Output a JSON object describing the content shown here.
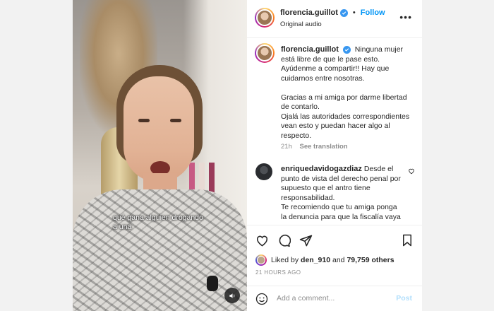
{
  "post": {
    "username": "florencia.guillot",
    "follow_label": "Follow",
    "audio": "Original audio",
    "video_caption": "qué gana alguien drogando a una",
    "caption": {
      "lines": [
        "Ninguna mujer está libre de que le pase esto. Ayúdenme a compartir!! Hay que cuidarnos entre nosotras.",
        "Gracias a mi amiga por darme libertad de contarlo.",
        "Ojalá las autoridades correspondientes vean esto y puedan hacer algo al respecto."
      ],
      "time": "21h",
      "see_translation": "See translation"
    },
    "comment": {
      "username": "enriquedavidogazdiaz",
      "text": "Desde el punto de vista del derecho penal por supuesto que el antro tiene responsabilidad.",
      "text2": "Te recomiendo que tu amiga ponga la denuncia para que la fiscalía vaya"
    },
    "likes": {
      "prefix": "Liked by",
      "user": "den_910",
      "connector": "and",
      "others": "79,759 others"
    },
    "timestamp": "21 HOURS AGO",
    "add_comment_placeholder": "Add a comment...",
    "post_label": "Post"
  },
  "icons": {
    "verified": "verified-badge-icon",
    "more": "more-options-icon",
    "like": "heart-icon",
    "comment": "comment-icon",
    "share": "share-icon",
    "save": "bookmark-icon",
    "emoji": "emoji-icon",
    "mute": "speaker-icon"
  },
  "colors": {
    "accent": "#0095f6",
    "verified": "#3897f0",
    "muted_text": "#8e8e8e",
    "post_disabled": "#b2dffc"
  }
}
